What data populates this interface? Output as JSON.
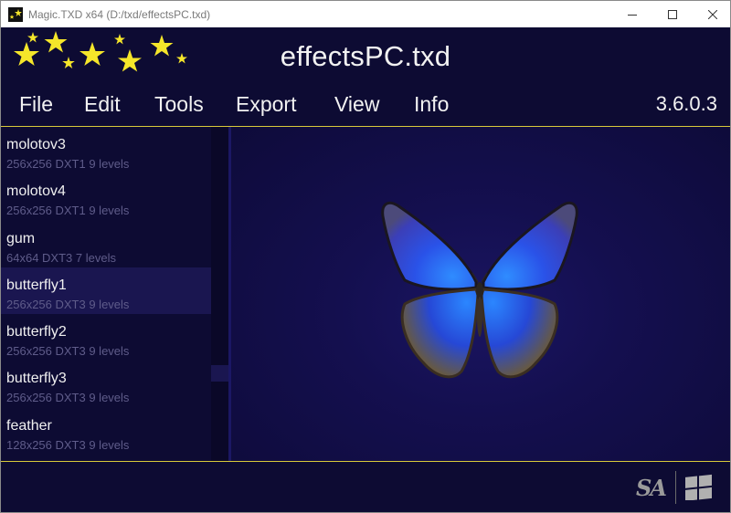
{
  "window": {
    "title": "Magic.TXD x64 (D:/txd/effectsPC.txd)"
  },
  "header": {
    "file_title": "effectsPC.txd",
    "version": "3.6.0.3"
  },
  "menu": {
    "items": [
      "File",
      "Edit",
      "Tools",
      "Export",
      "View",
      "Info"
    ]
  },
  "textures": [
    {
      "name": "molotov3",
      "info": "256x256 DXT1 9 levels",
      "selected": false
    },
    {
      "name": "molotov4",
      "info": "256x256 DXT1 9 levels",
      "selected": false
    },
    {
      "name": "gum",
      "info": "64x64 DXT3 7 levels",
      "selected": false
    },
    {
      "name": "butterfly1",
      "info": "256x256 DXT3 9 levels",
      "selected": true
    },
    {
      "name": "butterfly2",
      "info": "256x256 DXT3 9 levels",
      "selected": false
    },
    {
      "name": "butterfly3",
      "info": "256x256 DXT3 9 levels",
      "selected": false
    },
    {
      "name": "feather",
      "info": "128x256 DXT3 9 levels",
      "selected": false
    }
  ],
  "footer": {
    "game_logo": "SA",
    "platform_icon": "windows-icon"
  },
  "colors": {
    "background": "#0d0b33",
    "accent_line": "#d8c93a",
    "star": "#f5e62a",
    "selected_row": "#1a1650",
    "butterfly_blue": "#2f5cff"
  }
}
